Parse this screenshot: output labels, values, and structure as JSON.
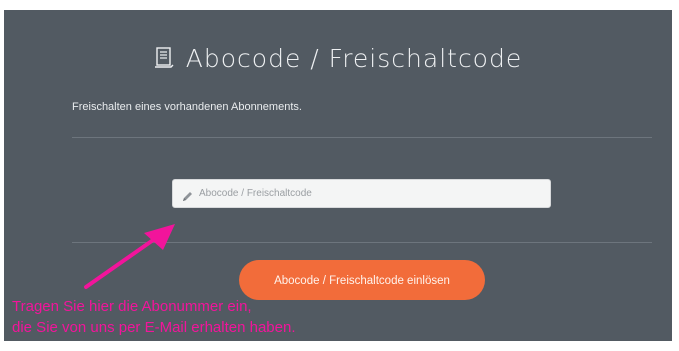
{
  "form": {
    "title": "Abocode / Freischaltcode",
    "subtitle": "Freischalten eines vorhandenen Abonnements.",
    "input_placeholder": "Abocode / Freischaltcode",
    "submit_label": "Abocode / Freischaltcode einlösen"
  },
  "annotation": {
    "line1": "Tragen Sie hier die Abonummer ein,",
    "line2": "die Sie von uns per E-Mail erhalten haben.",
    "color": "#f2149b"
  },
  "colors": {
    "panel_bg": "#525a62",
    "button_bg": "#f26c3a"
  },
  "icons": {
    "title_icon": "document-icon",
    "input_icon": "pencil-icon"
  }
}
